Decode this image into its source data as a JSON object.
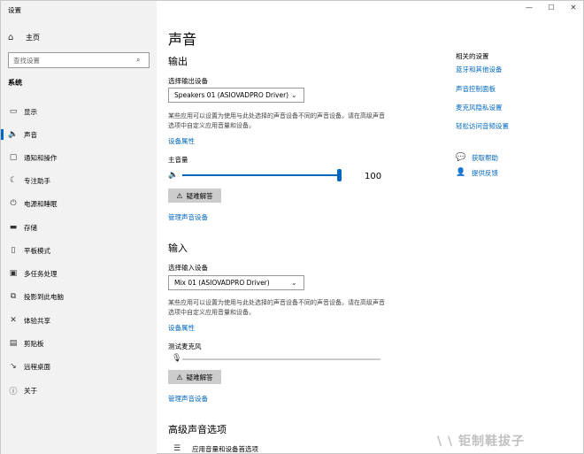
{
  "window": {
    "title": "设置",
    "minimize_glyph": "—",
    "maximize_glyph": "☐",
    "close_glyph": "✕"
  },
  "sidebar": {
    "home_label": "主页",
    "home_icon": "home-icon",
    "search_placeholder": "查找设置",
    "section_label": "系统",
    "items": [
      {
        "label": "显示",
        "icon": "monitor-icon",
        "glyph": "▭"
      },
      {
        "label": "声音",
        "icon": "speaker-icon",
        "glyph": "🔈",
        "active": true
      },
      {
        "label": "通知和操作",
        "icon": "notification-icon",
        "glyph": "▢"
      },
      {
        "label": "专注助手",
        "icon": "moon-icon",
        "glyph": "☾"
      },
      {
        "label": "电源和睡眠",
        "icon": "power-icon",
        "glyph": "⏻"
      },
      {
        "label": "存储",
        "icon": "drive-icon",
        "glyph": "▬"
      },
      {
        "label": "平板模式",
        "icon": "tablet-icon",
        "glyph": "▯"
      },
      {
        "label": "多任务处理",
        "icon": "multitask-icon",
        "glyph": "▣"
      },
      {
        "label": "投影到此电脑",
        "icon": "project-icon",
        "glyph": "⧉"
      },
      {
        "label": "体验共享",
        "icon": "share-icon",
        "glyph": "✕"
      },
      {
        "label": "剪贴板",
        "icon": "clipboard-icon",
        "glyph": "▤"
      },
      {
        "label": "远程桌面",
        "icon": "remote-icon",
        "glyph": "↘"
      },
      {
        "label": "关于",
        "icon": "info-icon",
        "glyph": "ⓘ"
      }
    ]
  },
  "main": {
    "page_title": "声音",
    "output": {
      "title": "输出",
      "device_label": "选择输出设备",
      "device_value": "Speakers 01 (ASIOVADPRO Driver)",
      "description": "某些应用可以设置为使用与此处选择的声音设备不同的声音设备。请在高级声音选项中自定义应用音量和设备。",
      "device_props_link": "设备属性",
      "master_volume_label": "主音量",
      "volume_value": "100",
      "volume_level": 1.0,
      "troubleshoot_label": "疑难解答",
      "manage_link": "管理声音设备"
    },
    "input": {
      "title": "输入",
      "device_label": "选择输入设备",
      "device_value": "Mix 01 (ASIOVADPRO Driver)",
      "description": "某些应用可以设置为使用与此处选择的声音设备不同的声音设备。请在高级声音选项中自定义应用音量和设备。",
      "device_props_link": "设备属性",
      "test_mic_label": "测试麦克风",
      "mic_level": 0.0,
      "troubleshoot_label": "疑难解答",
      "manage_link": "管理声音设备"
    },
    "advanced": {
      "title": "高级声音选项",
      "item_label": "应用音量和设备首选项"
    }
  },
  "related": {
    "title": "相关的设置",
    "links": [
      "蓝牙和其他设备",
      "声音控制面板",
      "麦克风隐私设置",
      "轻松访问音频设置"
    ],
    "help_label": "获取帮助",
    "feedback_label": "提供反馈"
  },
  "watermark": "\\  \\ 钜制鞋拔子",
  "colors": {
    "accent": "#0067c0",
    "sidebar_bg": "#f2f2f2",
    "button_bg": "#cccccc"
  }
}
